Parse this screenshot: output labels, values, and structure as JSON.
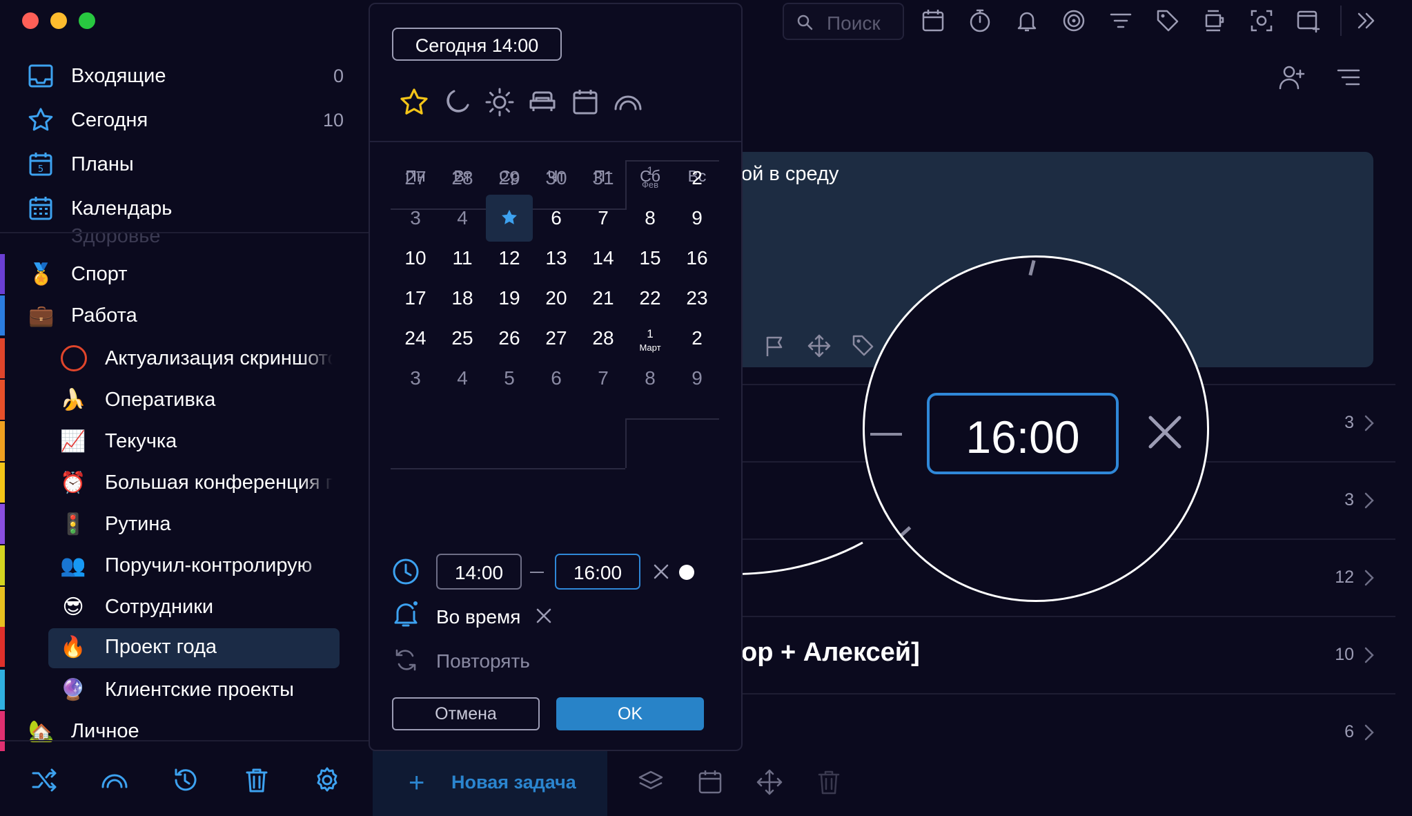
{
  "sidebar": {
    "nav": [
      {
        "label": "Входящие",
        "count": "0"
      },
      {
        "label": "Сегодня",
        "count": "10"
      },
      {
        "label": "Планы",
        "count": ""
      },
      {
        "label": "Календарь",
        "count": ""
      }
    ],
    "ghost_item": "Здоровье",
    "areas": [
      {
        "emoji": "🏅",
        "label": "Спорт",
        "color": "#6b3fd4"
      },
      {
        "emoji": "💼",
        "label": "Работа",
        "color": "#2b7de0"
      }
    ],
    "projects": [
      {
        "emoji": "",
        "label": "Актуализация скриншотов",
        "color": "#e0452b"
      },
      {
        "emoji": "🍌",
        "label": "Оперативка",
        "color": "#e8502a"
      },
      {
        "emoji": "📈",
        "label": "Текучка",
        "color": "#f0a020"
      },
      {
        "emoji": "⏰",
        "label": "Большая конференция г",
        "color": "#f4c518"
      },
      {
        "emoji": "🚦",
        "label": "Рутина",
        "color": "#8a4fe0"
      },
      {
        "emoji": "👥",
        "label": "Поручил-контролирую",
        "color": "#d4d420"
      },
      {
        "emoji": "😎",
        "label": "Сотрудники",
        "color": "#e8c020"
      },
      {
        "emoji": "🔥",
        "label": "Проект года",
        "color": "#e0302b"
      },
      {
        "emoji": "🔮",
        "label": "Клиентские проекты",
        "color": "#30b0e0"
      }
    ],
    "personal": {
      "emoji": "🏡",
      "label": "Личное",
      "color": "#e03070"
    }
  },
  "search": {
    "placeholder": "Поиск"
  },
  "main": {
    "card_text": "ой в среду",
    "rows": [
      {
        "count": "3"
      },
      {
        "count": "3"
      },
      {
        "count": "12"
      },
      {
        "count": "10"
      },
      {
        "count": "6"
      }
    ],
    "row_title": "ор + Алексей]",
    "new_task": "Новая задача"
  },
  "popover": {
    "date_badge": "Сегодня 14:00",
    "weekdays": [
      "Пн",
      "Вт",
      "Ср",
      "Чт",
      "Пт",
      "Сб",
      "Вс"
    ],
    "weeks": [
      [
        "27",
        "28",
        "29",
        "30",
        "31",
        "1|Фев",
        "2"
      ],
      [
        "3",
        "4",
        "★",
        "6",
        "7",
        "8",
        "9"
      ],
      [
        "10",
        "11",
        "12",
        "13",
        "14",
        "15",
        "16"
      ],
      [
        "17",
        "18",
        "19",
        "20",
        "21",
        "22",
        "23"
      ],
      [
        "24",
        "25",
        "26",
        "27",
        "28",
        "1|Март",
        "2"
      ],
      [
        "3",
        "4",
        "5",
        "6",
        "7",
        "8",
        "9"
      ]
    ],
    "time_start": "14:00",
    "time_end": "16:00",
    "reminder": "Во время",
    "repeat": "Повторять",
    "cancel": "Отмена",
    "ok": "OK"
  },
  "zoom": {
    "time": "16:00"
  },
  "colors": {
    "accent": "#2883c8",
    "highlight": "#1b2b46",
    "star": "#f4c518"
  }
}
